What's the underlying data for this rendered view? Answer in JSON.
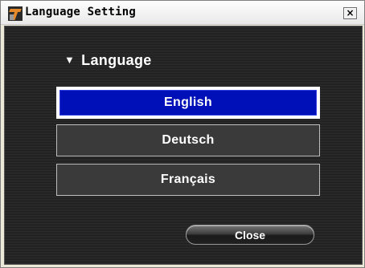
{
  "window": {
    "title": "Language Setting",
    "close_glyph": "×"
  },
  "section": {
    "marker": "▼",
    "header": "Language"
  },
  "languages": [
    {
      "label": "English",
      "selected": true
    },
    {
      "label": "Deutsch",
      "selected": false
    },
    {
      "label": "Français",
      "selected": false
    }
  ],
  "footer": {
    "close_label": "Close"
  },
  "colors": {
    "selected_fill": "#0010b8",
    "panel_bg": "#2a2a2a",
    "accent_icon": "#e58a2a"
  }
}
